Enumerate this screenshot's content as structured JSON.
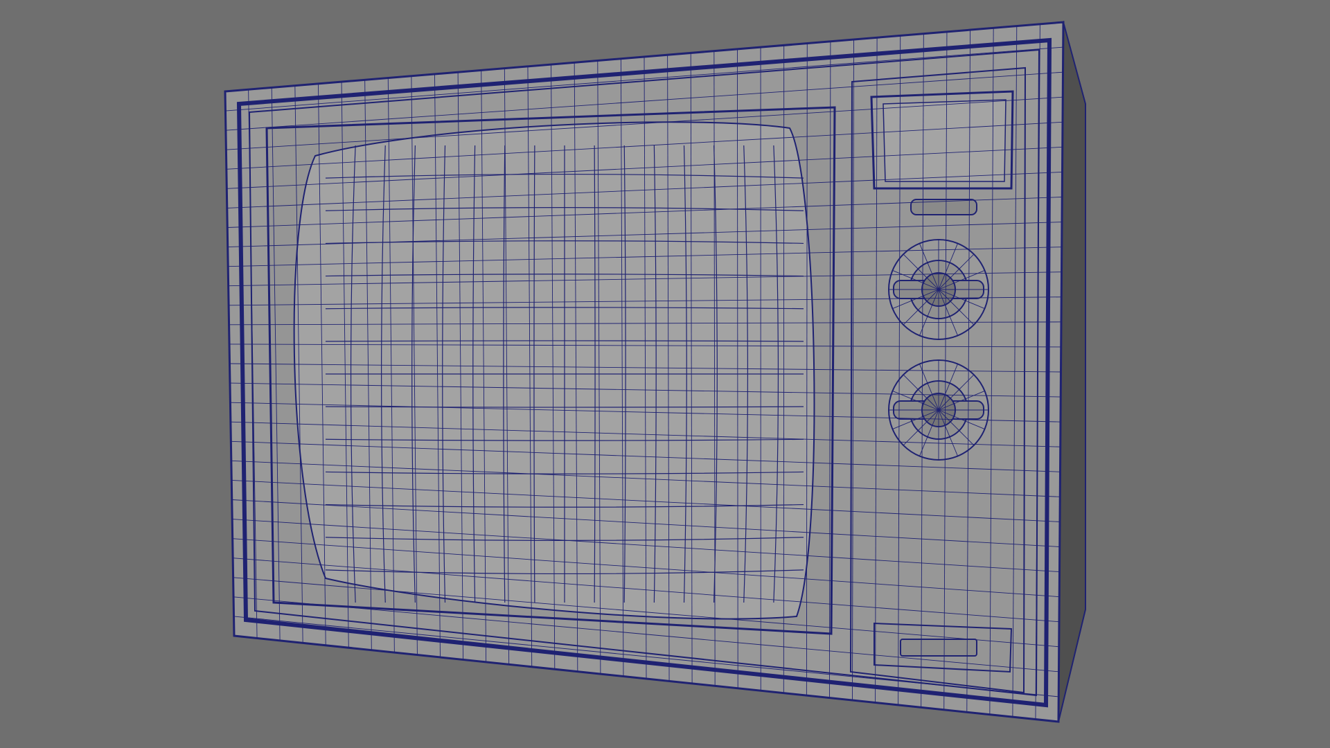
{
  "viewport": {
    "background": "#6f6f6f",
    "wire_color": "#1f2272",
    "faces": {
      "front": "#9a9a9a",
      "screen": "#a1a1a1",
      "side": "#4f4f4f",
      "bezel": "#8f8f8f",
      "panel": "#979797"
    }
  },
  "scene": {
    "object_icon": "crt-television-wireframe",
    "components": [
      "body",
      "screen",
      "control-panel",
      "display-window",
      "knob-upper",
      "knob-lower",
      "switch-slot"
    ]
  }
}
